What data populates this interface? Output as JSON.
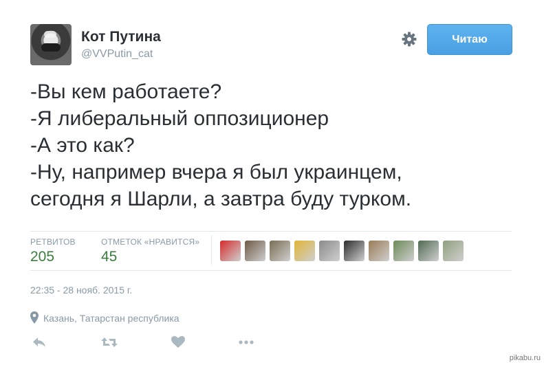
{
  "author": {
    "name": "Кот Путина",
    "handle": "@VVPutin_cat"
  },
  "follow_button": {
    "label": "Читаю",
    "color": "#55acee"
  },
  "tweet": {
    "lines": [
      "-Вы кем работаете?",
      "-Я либеральный оппозиционер",
      "-А это как?",
      "-Ну, например вчера я был украинцем,",
      "сегодня я Шарли, а завтра буду турком."
    ]
  },
  "stats": {
    "retweets": {
      "label": "РЕТВИТОВ",
      "value": "205"
    },
    "likes": {
      "label": "ОТМЕТОК «НРАВИТСЯ»",
      "value": "45"
    }
  },
  "likers": [
    {
      "icon": "liker-avatar-icon",
      "color": "#d62a2a"
    },
    {
      "icon": "liker-avatar-icon",
      "color": "#6f5a46"
    },
    {
      "icon": "liker-avatar-icon",
      "color": "#7a6d52"
    },
    {
      "icon": "liker-avatar-icon",
      "color": "#e0b534"
    },
    {
      "icon": "liker-avatar-icon",
      "color": "#8b8b8b"
    },
    {
      "icon": "liker-avatar-icon",
      "color": "#2c2c2c"
    },
    {
      "icon": "liker-avatar-icon",
      "color": "#9a7c56"
    },
    {
      "icon": "liker-avatar-icon",
      "color": "#6c8a57"
    },
    {
      "icon": "liker-avatar-icon",
      "color": "#4f6b52"
    },
    {
      "icon": "liker-avatar-icon",
      "color": "#90a07d"
    }
  ],
  "timestamp": "22:35 - 28 нояб. 2015 г.",
  "location": "Казань, Татарстан республика",
  "actions": [
    "reply-icon",
    "retweet-icon",
    "like-icon",
    "more-icon"
  ],
  "watermark": "pikabu.ru"
}
